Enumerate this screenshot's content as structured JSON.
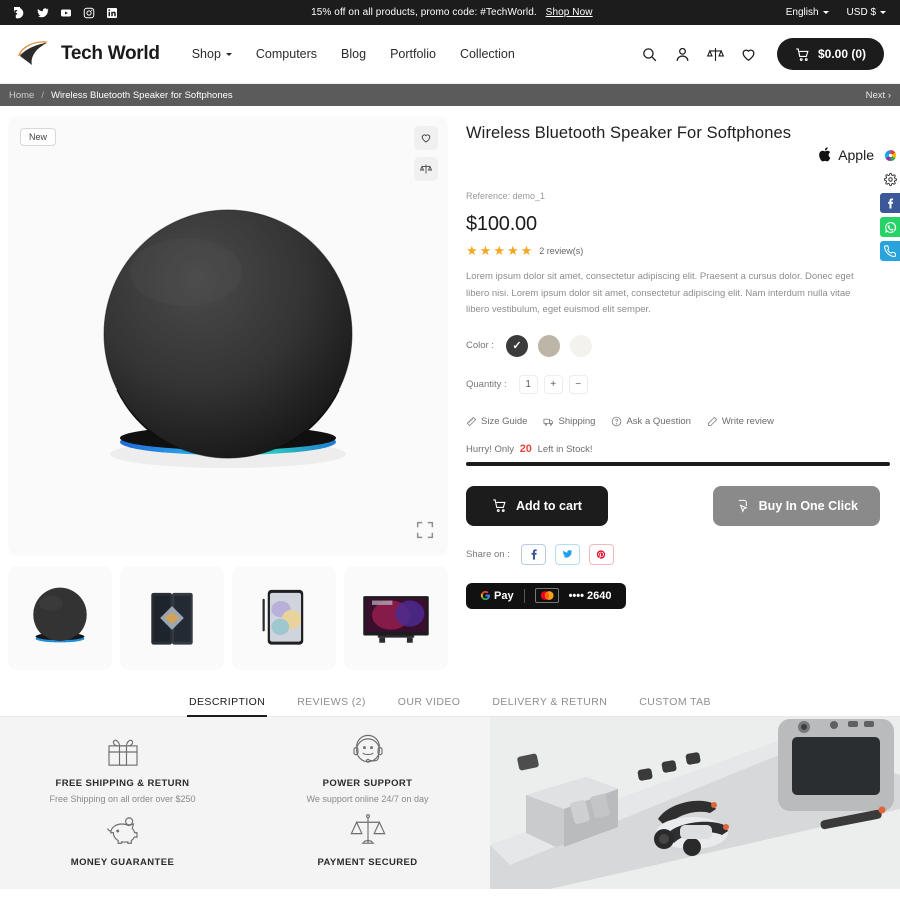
{
  "topbar": {
    "social": [
      {
        "name": "facebook-icon",
        "label": "Facebook"
      },
      {
        "name": "twitter-icon",
        "label": "Twitter"
      },
      {
        "name": "youtube-icon",
        "label": "YouTube"
      },
      {
        "name": "instagram-icon",
        "label": "Instagram"
      },
      {
        "name": "linkedin-icon",
        "label": "LinkedIn"
      }
    ],
    "promo_text": "15% off on all products, promo code: #TechWorld.",
    "shop_now": "Shop Now",
    "language": "English",
    "currency": "USD $"
  },
  "header": {
    "brand_name": "Tech World",
    "nav": [
      {
        "label": "Shop",
        "has_caret": true
      },
      {
        "label": "Computers",
        "has_caret": false
      },
      {
        "label": "Blog",
        "has_caret": false
      },
      {
        "label": "Portfolio",
        "has_caret": false
      },
      {
        "label": "Collection",
        "has_caret": false
      }
    ],
    "icons": [
      "search-icon",
      "account-icon",
      "compare-icon",
      "wishlist-icon"
    ],
    "cart_label": "$0.00 (0)"
  },
  "breadcrumb": {
    "home": "Home",
    "separator": "/",
    "current": "Wireless Bluetooth Speaker for Softphones",
    "next": "Next"
  },
  "gallery": {
    "badge": "New",
    "actions": [
      "wishlist-icon",
      "compare-icon"
    ],
    "expand": "expand-icon",
    "thumbnails": [
      {
        "name": "thumb-speaker",
        "alt": "Smart speaker"
      },
      {
        "name": "thumb-foldable-phone",
        "alt": "Foldable phone"
      },
      {
        "name": "thumb-tablet",
        "alt": "Tablet"
      },
      {
        "name": "thumb-tv",
        "alt": "Sony TV"
      }
    ]
  },
  "product": {
    "title": "Wireless Bluetooth Speaker For Softphones",
    "brand": "Apple",
    "reference": "Reference: demo_1",
    "price": "$100.00",
    "stars": 5,
    "reviews": "2 review(s)",
    "description": "Lorem ipsum dolor sit amet, consectetur adipiscing elit. Praesent a cursus dolor. Donec eget libero nisi. Lorem ipsum dolor sit amet, consectetur adipiscing elit. Nam interdum nulla vitae libero vestibulum, eget euismod elit semper.",
    "color_label": "Color :",
    "colors": [
      {
        "name": "black",
        "hex": "#3b3b3b",
        "selected": true
      },
      {
        "name": "taupe",
        "hex": "#bdb5a8",
        "selected": false
      },
      {
        "name": "cream",
        "hex": "#f4f2ec",
        "selected": false
      }
    ],
    "quantity_label": "Quantity :",
    "quantity_value": "1",
    "quantity_plus": "+",
    "quantity_minus": "−",
    "links": [
      {
        "label": "Size Guide",
        "icon": "ruler-icon"
      },
      {
        "label": "Shipping",
        "icon": "truck-icon"
      },
      {
        "label": "Ask a Question",
        "icon": "question-icon"
      },
      {
        "label": "Write review",
        "icon": "pencil-icon"
      }
    ],
    "stock_prefix": "Hurry! Only",
    "stock_count": "20",
    "stock_suffix": "Left in Stock!",
    "add_to_cart": "Add to cart",
    "buy_one_click": "Buy In One Click",
    "share_label": "Share on :",
    "share_buttons": [
      {
        "name": "facebook-share",
        "glyph": "f",
        "color": "#3b5998"
      },
      {
        "name": "twitter-share",
        "glyph": "t",
        "color": "#1da1f2"
      },
      {
        "name": "pinterest-share",
        "glyph": "P",
        "color": "#e60023"
      }
    ],
    "payment": {
      "gpay": "Pay",
      "card_digits": "•••• 2640"
    }
  },
  "floatbar": [
    {
      "name": "color-wheel-icon",
      "bg": "#ffffff"
    },
    {
      "name": "gear-icon",
      "bg": "#ffffff"
    },
    {
      "name": "facebook-icon",
      "bg": "#3b5998"
    },
    {
      "name": "whatsapp-icon",
      "bg": "#25d366"
    },
    {
      "name": "phone-icon",
      "bg": "#29a3dc"
    }
  ],
  "tabs": [
    {
      "label": "DESCRIPTION",
      "active": true
    },
    {
      "label": "REVIEWS (2)",
      "active": false
    },
    {
      "label": "OUR VIDEO",
      "active": false
    },
    {
      "label": "DELIVERY & RETURN",
      "active": false
    },
    {
      "label": "CUSTOM TAB",
      "active": false
    }
  ],
  "features": [
    {
      "icon": "gift-icon",
      "title": "FREE SHIPPING & RETURN",
      "subtitle": "Free Shipping on all order over $250"
    },
    {
      "icon": "headset-icon",
      "title": "POWER SUPPORT",
      "subtitle": "We support online 24/7 on day"
    },
    {
      "icon": "piggy-bank-icon",
      "title": "MONEY GUARANTEE",
      "subtitle": ""
    },
    {
      "icon": "scales-icon",
      "title": "PAYMENT SECURED",
      "subtitle": ""
    }
  ]
}
